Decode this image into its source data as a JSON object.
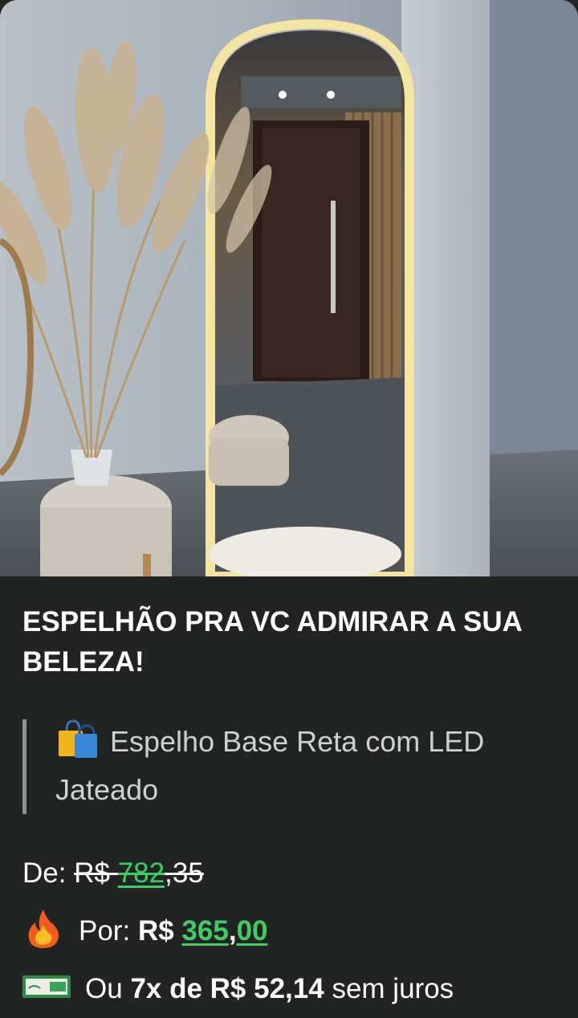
{
  "post": {
    "title": "ESPELHÃO PRA VC ADMIRAR A SUA BELEZA!",
    "product_name": "Espelho Base Reta com LED Jateado",
    "price_from_label": "De:",
    "price_from_currency": "R$",
    "price_from_int": "782",
    "price_from_dec": ",35",
    "price_by_label": "Por:",
    "price_by_currency": "R$",
    "price_by_int": "365",
    "price_by_sep": ",",
    "price_by_dec": "00",
    "installment_prefix": "Ou",
    "installment_bold": "7x de R$ 52,14",
    "installment_suffix": "sem juros"
  },
  "icons": {
    "bag": "shopping-bags-icon",
    "fire": "fire-icon",
    "cash": "banknote-icon"
  },
  "colors": {
    "background": "#222423",
    "price_green": "#3ecd63",
    "quote_bar": "#8f9192"
  }
}
